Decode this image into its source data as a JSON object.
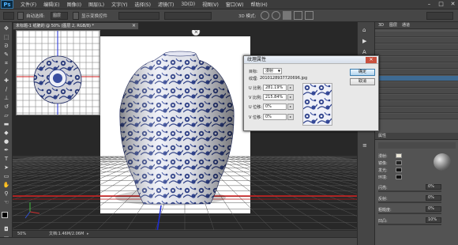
{
  "app": {
    "logo": "Ps"
  },
  "menu": [
    "文件(F)",
    "编辑(E)",
    "图像(I)",
    "图层(L)",
    "文字(Y)",
    "选择(S)",
    "滤镜(T)",
    "3D(D)",
    "视图(V)",
    "窗口(W)",
    "帮助(H)"
  ],
  "window_controls": [
    "minimize-icon",
    "maximize-icon",
    "close-icon"
  ],
  "options": {
    "auto_select_label": "自动选择:",
    "auto_select_value": "图层",
    "show_transform": "显示变换控件",
    "mode_3d_label": "3D 模式:"
  },
  "document": {
    "tab_title": "未标题-1 纸脆的 @ 50% (图层 2, RGB/8) *"
  },
  "status": {
    "zoom": "50%",
    "doc_info": "文档:1.46M/2.06M"
  },
  "dialog": {
    "title": "纹理属性",
    "target_label": "目标:",
    "target_value": "漫射",
    "texture_label": "纹理:",
    "texture_value": "2010128937720696.jpg",
    "u_scale_label": "U 比例:",
    "u_scale_value": "281.19%",
    "v_scale_label": "V 比例:",
    "v_scale_value": "215.84%",
    "u_offset_label": "U 位移:",
    "u_offset_value": "0%",
    "v_offset_label": "V 位移:",
    "v_offset_value": "0%",
    "ok": "确定",
    "cancel": "取消"
  },
  "right_panel": {
    "tabs": [
      "3D",
      "图层",
      "通道"
    ],
    "props_title": "属性",
    "prop_labels": [
      "漫射:",
      "镜像:",
      "发光:",
      "环境:",
      "闪亮:",
      "反射:",
      "粗糙度:",
      "凹凸:"
    ],
    "prop_values": [
      "",
      "",
      "",
      "",
      "0%",
      "0%",
      "0%",
      "10%"
    ]
  },
  "colors": {
    "accent": "#3e6a92",
    "vase_blue": "#2c3f8a",
    "grid_red": "#d21c1c"
  }
}
